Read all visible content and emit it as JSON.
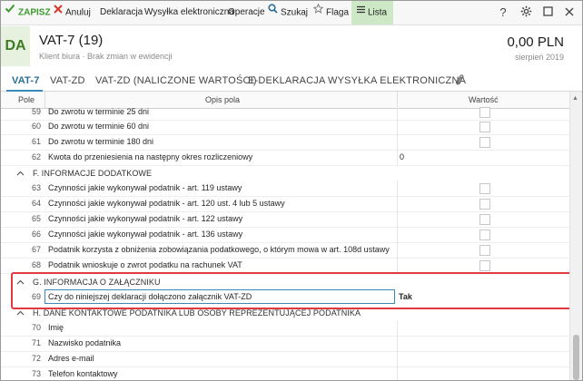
{
  "toolbar": {
    "save": "ZAPISZ",
    "cancel": "Anuluj",
    "declaration": "Deklaracja",
    "sending": "Wysyłka elektroniczna",
    "operations": "Operacje",
    "search": "Szukaj",
    "flag": "Flaga",
    "list": "Lista",
    "help": "?",
    "colors": {
      "save": "#3a9a2c",
      "cancel": "#d23b2b",
      "search": "#2a6f97"
    }
  },
  "header": {
    "avatar": "DA",
    "title": "VAT-7 (19)",
    "subtitle": "Klient biura · Brak zmian w ewidencji",
    "amount": "0,00 PLN",
    "period": "sierpień 2019"
  },
  "tabs": [
    {
      "label": "VAT-7",
      "active": true
    },
    {
      "label": "VAT-ZD"
    },
    {
      "label": "VAT-ZD (NALICZONE WARTOŚCI)"
    },
    {
      "label": "E-DEKLARACJA"
    },
    {
      "label": "WYSYŁKA ELEKTRONICZNA"
    }
  ],
  "table": {
    "col_pole": "Pole",
    "col_opis": "Opis pola",
    "col_wartosc": "Wartość",
    "rows_e": [
      {
        "num": "59",
        "desc": "Do zwrotu w terminie 25 dni",
        "type": "check"
      },
      {
        "num": "60",
        "desc": "Do zwrotu w terminie 60 dni",
        "type": "check"
      },
      {
        "num": "61",
        "desc": "Do zwrotu w terminie 180 dni",
        "type": "check"
      },
      {
        "num": "62",
        "desc": "Kwota do przeniesienia na następny okres rozliczeniowy",
        "value": "0"
      }
    ],
    "section_f": "F. INFORMACJE DODATKOWE",
    "rows_f": [
      {
        "num": "63",
        "desc": "Czynności jakie wykonywał podatnik - art. 119 ustawy",
        "type": "check"
      },
      {
        "num": "64",
        "desc": "Czynności jakie wykonywał podatnik - art. 120 ust. 4 lub 5 ustawy",
        "type": "check"
      },
      {
        "num": "65",
        "desc": "Czynności jakie wykonywał podatnik - art. 122 ustawy",
        "type": "check"
      },
      {
        "num": "66",
        "desc": "Czynności jakie wykonywał podatnik - art. 136 ustawy",
        "type": "check"
      },
      {
        "num": "67",
        "desc": "Podatnik korzysta z obniżenia zobowiązania podatkowego, o którym mowa w art. 108d ustawy",
        "type": "check"
      },
      {
        "num": "68",
        "desc": "Podatnik wnioskuje o zwrot podatku na rachunek VAT",
        "type": "check"
      }
    ],
    "section_g": "G. INFORMACJA O ZAŁĄCZNIKU",
    "row_g": {
      "num": "69",
      "desc": "Czy do niniejszej deklaracji dołączono załącznik VAT-ZD",
      "value": "Tak"
    },
    "section_h": "H. DANE KONTAKTOWE PODATNIKA LUB OSOBY REPREZENTUJĄCEJ PODATNIKA",
    "rows_h": [
      {
        "num": "70",
        "desc": "Imię"
      },
      {
        "num": "71",
        "desc": "Nazwisko podatnika"
      },
      {
        "num": "72",
        "desc": "Adres e-mail"
      },
      {
        "num": "73",
        "desc": "Telefon kontaktowy"
      }
    ]
  }
}
